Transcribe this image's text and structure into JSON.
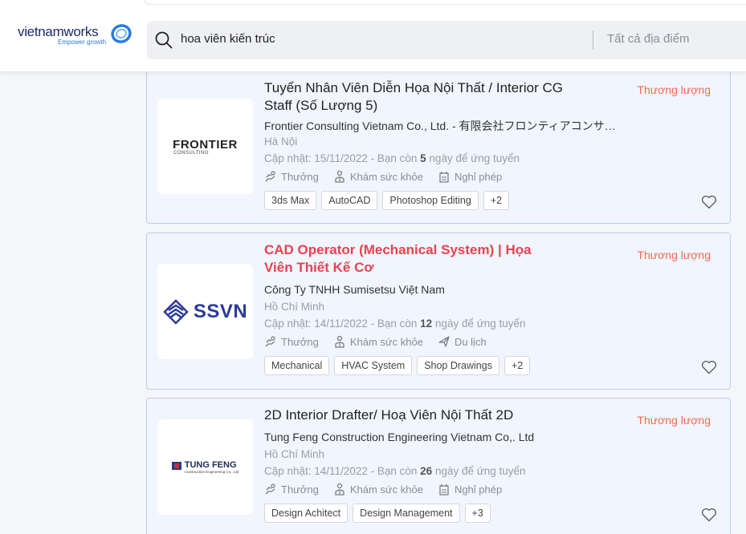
{
  "header": {
    "logo_text": "vietnamworks",
    "logo_tagline": "Empower growth",
    "search_value": "hoa viên kiến trúc",
    "location_placeholder": "Tất cả địa điểm"
  },
  "jobs": [
    {
      "title": "Tuyển Nhân Viên Diễn Họa Nội Thất / Interior CG Staff (Số Lượng 5)",
      "salary": "Thương lượng",
      "company": "Frontier Consulting Vietnam Co., Ltd. - 有限会社フロンティアコンサルティング",
      "logo_name": "FRONTIER",
      "logo_sub": "CONSULTING",
      "location": "Hà Nội",
      "updated_prefix": "Cập nhật: 15/11/2022 - Bạn còn ",
      "days": "5",
      "updated_suffix": " ngày để ứng tuyển",
      "benefits": [
        "Thưởng",
        "Khám sức khỏe",
        "Nghỉ phép"
      ],
      "tags": [
        "3ds Max",
        "AutoCAD",
        "Photoshop Editing",
        "+2"
      ]
    },
    {
      "title": "CAD Operator (Mechanical System) | Họa Viên Thiết Kế Cơ",
      "salary": "Thương lượng",
      "company": "Công Ty TNHH Sumisetsu Việt Nam",
      "logo_name": "SSVN",
      "location": "Hồ Chí Minh",
      "updated_prefix": "Cập nhật: 14/11/2022 - Bạn còn ",
      "days": "12",
      "updated_suffix": " ngày để ứng tuyển",
      "benefits": [
        "Thưởng",
        "Khám sức khỏe",
        "Du lịch"
      ],
      "tags": [
        "Mechanical",
        "HVAC System",
        "Shop Drawings",
        "+2"
      ]
    },
    {
      "title": "2D Interior Drafter/ Hoạ Viên Nội Thất 2D",
      "salary": "Thương lượng",
      "company": "Tung Feng Construction Engineering Vietnam Co,. Ltd",
      "logo_name": "TUNG FENG",
      "logo_sub": "Construction Engineering Co., Ltd",
      "location": "Hồ Chí Minh",
      "updated_prefix": "Cập nhật: 14/11/2022 - Bạn còn ",
      "days": "26",
      "updated_suffix": " ngày để ứng tuyển",
      "benefits": [
        "Thưởng",
        "Khám sức khỏe",
        "Nghỉ phép"
      ],
      "tags": [
        "Design Achitect",
        "Design Management",
        "+3"
      ]
    }
  ]
}
